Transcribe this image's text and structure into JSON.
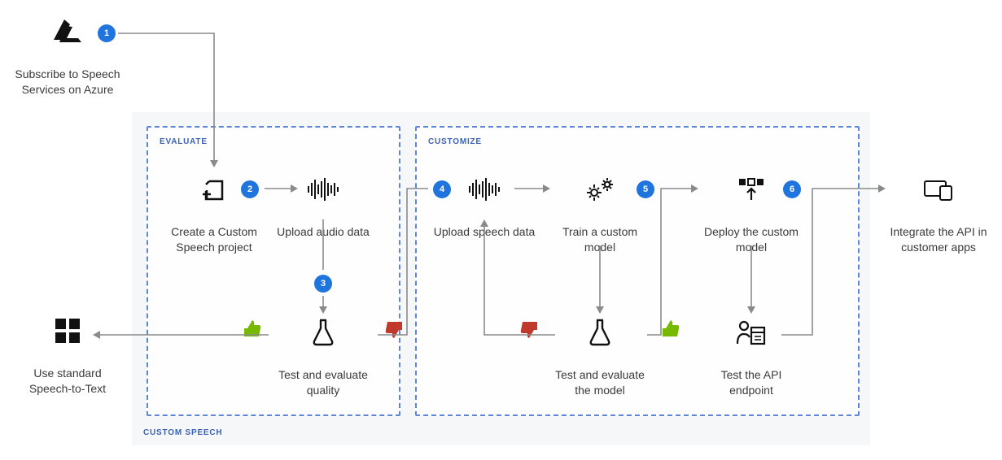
{
  "external": {
    "subscribe": {
      "label": "Subscribe to Speech Services on Azure",
      "icon": "azure-icon"
    },
    "standard": {
      "label": "Use standard Speech-to-Text",
      "icon": "windows-icon"
    },
    "integrate": {
      "label": "Integrate the API in customer apps",
      "icon": "devices-icon"
    }
  },
  "panels": {
    "outer": {
      "label": "CUSTOM SPEECH"
    },
    "evaluate": {
      "label": "EVALUATE"
    },
    "customize": {
      "label": "CUSTOMIZE"
    }
  },
  "badges": {
    "b1": "1",
    "b2": "2",
    "b3": "3",
    "b4": "4",
    "b5": "5",
    "b6": "6"
  },
  "steps": {
    "create_project": {
      "label": "Create a Custom Speech project"
    },
    "upload_audio": {
      "label": "Upload audio data"
    },
    "test_quality": {
      "label": "Test and evaluate quality"
    },
    "upload_speech": {
      "label": "Upload speech data"
    },
    "train_model": {
      "label": "Train a custom model"
    },
    "deploy_model": {
      "label": "Deploy the custom model"
    },
    "test_model": {
      "label": "Test and evaluate the model"
    },
    "test_endpoint": {
      "label": "Test the API endpoint"
    }
  },
  "colors": {
    "accent": "#1f74de",
    "panel_border": "#5d87d6",
    "panel_bg": "#f6f7f8",
    "good": "#76b900",
    "bad": "#c0392b"
  }
}
